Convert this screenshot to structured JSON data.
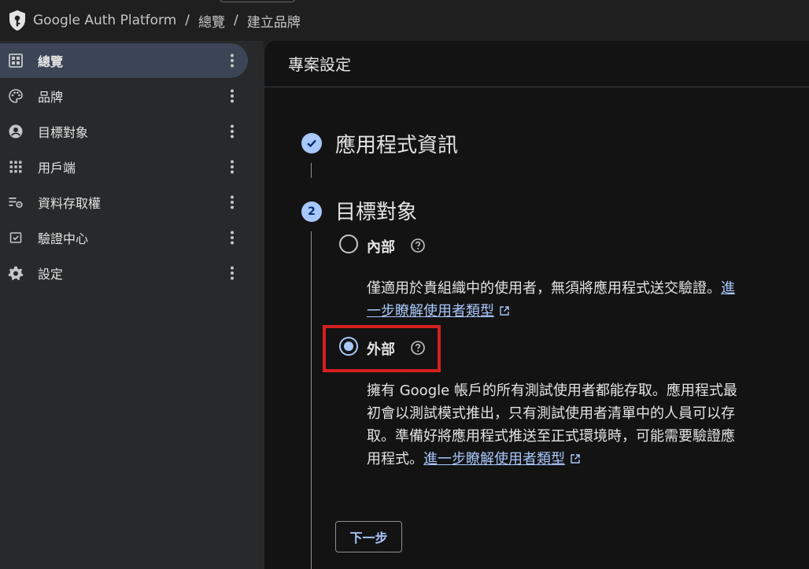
{
  "breadcrumb": [
    "Google Auth Platform",
    "總覽",
    "建立品牌"
  ],
  "breadcrumb_separator": "/",
  "sidebar": {
    "items": [
      {
        "label": "總覽",
        "icon": "dashboard-icon",
        "active": true
      },
      {
        "label": "品牌",
        "icon": "palette-icon",
        "active": false
      },
      {
        "label": "目標對象",
        "icon": "account-circle-icon",
        "active": false
      },
      {
        "label": "用戶端",
        "icon": "apps-grid-icon",
        "active": false
      },
      {
        "label": "資料存取權",
        "icon": "data-access-icon",
        "active": false
      },
      {
        "label": "驗證中心",
        "icon": "verification-icon",
        "active": false
      },
      {
        "label": "設定",
        "icon": "gear-icon",
        "active": false
      }
    ]
  },
  "main": {
    "title": "專案設定",
    "steps": [
      {
        "title": "應用程式資訊",
        "status": "complete"
      },
      {
        "number": "2",
        "title": "目標對象",
        "status": "current"
      }
    ],
    "options": {
      "internal": {
        "label": "內部",
        "selected": false,
        "desc_line1": "僅適用於貴組織中的使用者，無須將應用程式送交驗證。",
        "link_part1": "進",
        "link_part2": "一步瞭解使用者類型"
      },
      "external": {
        "label": "外部",
        "selected": true,
        "desc_line1": "擁有 Google 帳戶的所有測試使用者都能存取。應用程式最",
        "desc_line2": "初會以測試模式推出，只有測試使用者清單中的人員可以存",
        "desc_line3": "取。準備好將應用程式推送至正式環境時，可能需要驗證應",
        "desc_line4_prefix": "用程式。",
        "link": "進一步瞭解使用者類型"
      }
    },
    "next_button": "下一步"
  },
  "colors": {
    "accent": "#a8c7fa",
    "highlight": "#d61f1f",
    "sidebar_bg": "#28292a",
    "main_bg": "#131314"
  }
}
